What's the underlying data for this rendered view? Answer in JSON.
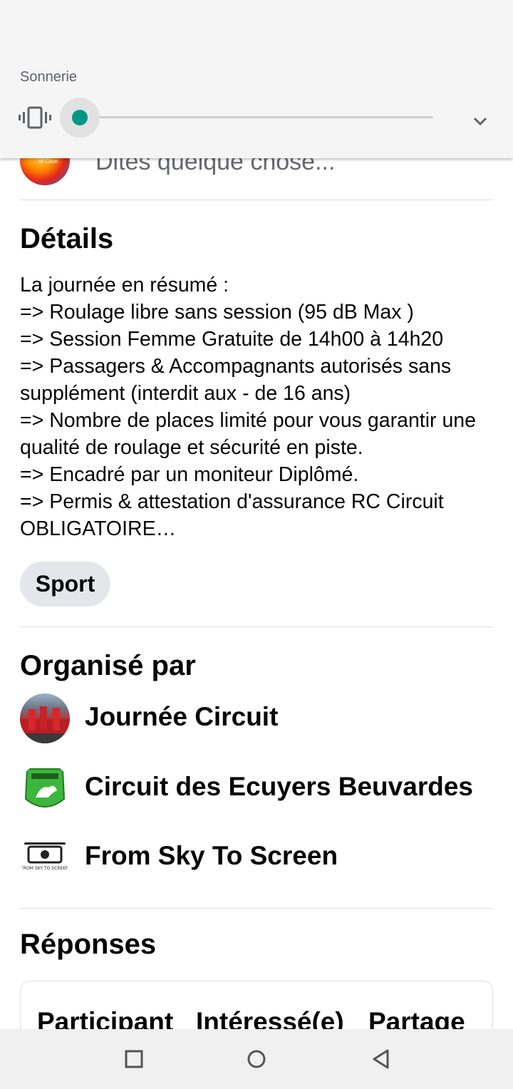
{
  "volume_panel": {
    "label": "Sonnerie",
    "level": 0,
    "mode_icon": "vibrate-icon",
    "expand_icon": "chevron-down-icon",
    "accent_color": "#009688"
  },
  "composer": {
    "placeholder": "Dites quelque chose...",
    "avatar_caption": "of Gilon"
  },
  "details": {
    "title": "Détails",
    "text": "La journée en résumé :\n=> Roulage libre sans session (95 dB Max )\n=> Session Femme Gratuite de 14h00 à 14h20\n=> Passagers & Accompagnants autorisés sans supplément (interdit aux - de 16 ans)\n=> Nombre de places limité pour vous garantir une qualité de roulage et sécurité en piste.\n=> Encadré par un moniteur Diplômé.\n=> Permis & attestation d'assurance RC Circuit OBLIGATOIRE…",
    "category_chip": "Sport"
  },
  "organizers": {
    "title": "Organisé par",
    "items": [
      {
        "name": "Journée Circuit"
      },
      {
        "name": "Circuit des Ecuyers Beuvardes"
      },
      {
        "name": "From Sky To Screen",
        "logo_text": "FROM SKY TO SCREEN"
      }
    ]
  },
  "responses": {
    "title": "Réponses",
    "columns": [
      "Participant",
      "Intéressé(e)",
      "Partage"
    ]
  },
  "navbar": {
    "buttons": [
      "recents-square-icon",
      "home-circle-icon",
      "back-triangle-icon"
    ]
  }
}
